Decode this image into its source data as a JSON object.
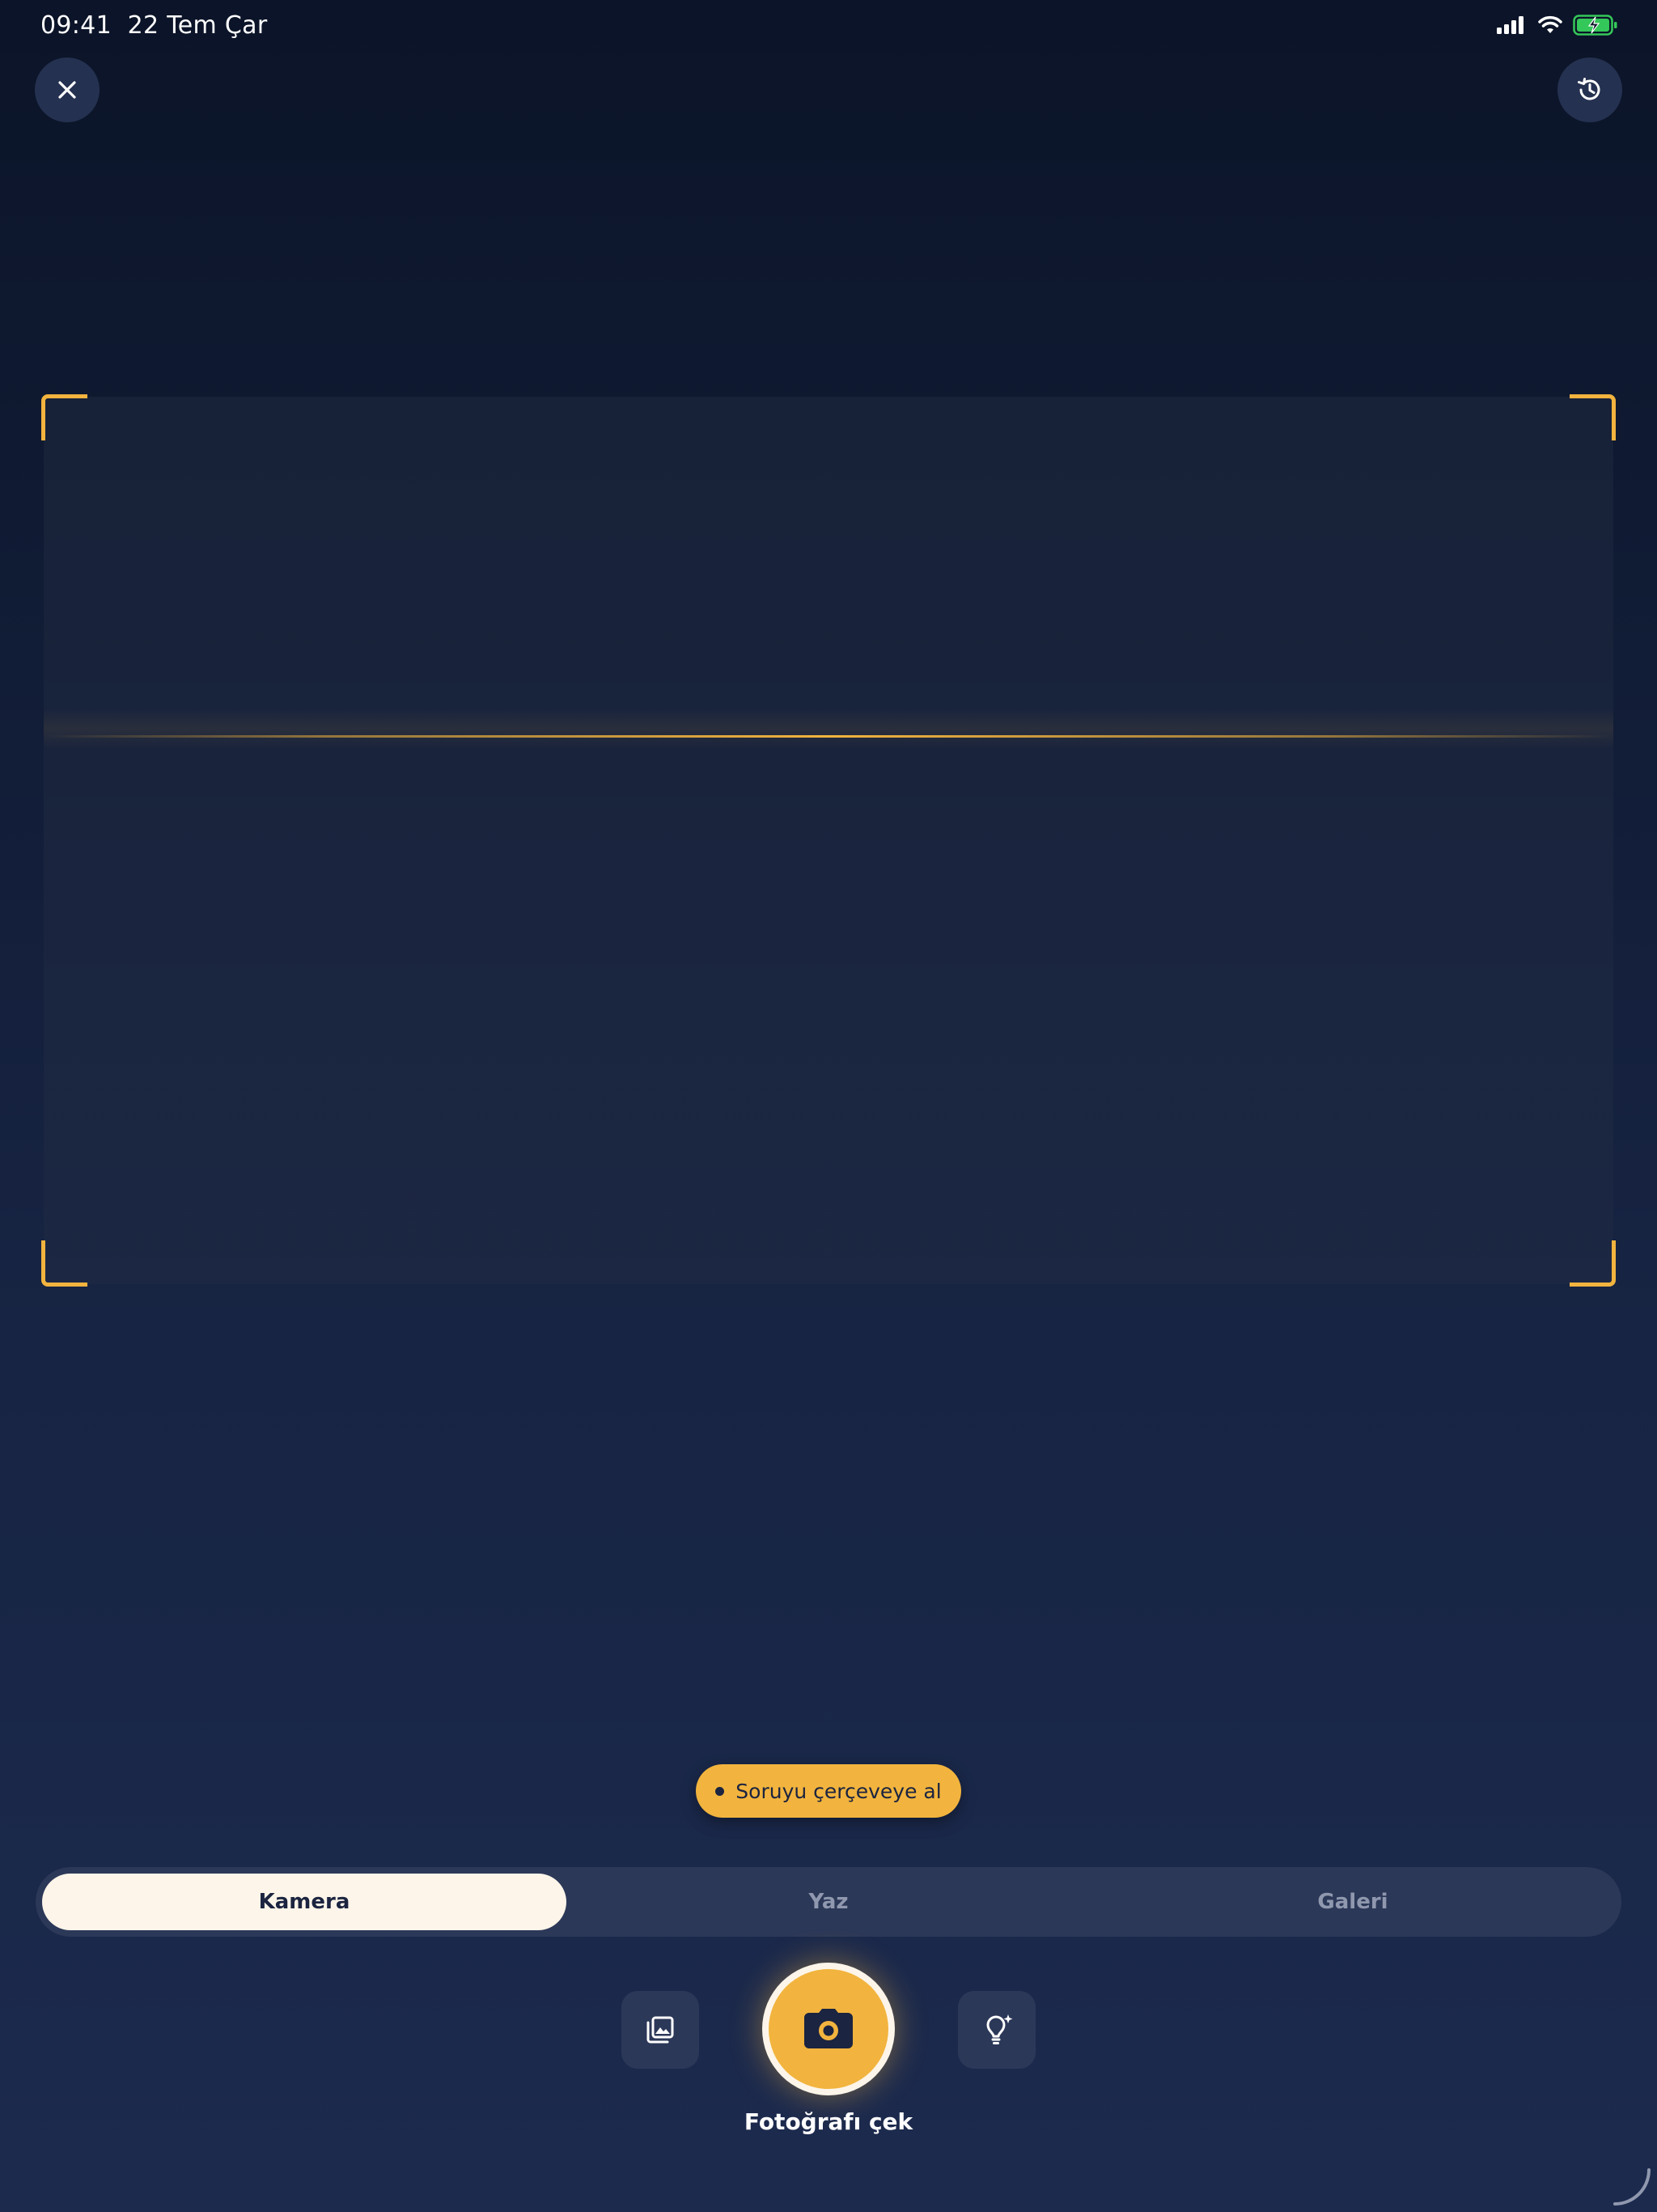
{
  "status_bar": {
    "time": "09:41",
    "date": "22 Tem Çar",
    "icons": [
      "cellular-signal-icon",
      "wifi-icon",
      "battery-charging-icon"
    ]
  },
  "top_bar": {
    "close_icon": "close-icon",
    "history_icon": "history-icon"
  },
  "scan_area": {
    "accent_color": "#f2b43e"
  },
  "hint": {
    "text": "Soruyu çerçeveye al"
  },
  "mode_tabs": {
    "items": [
      {
        "label": "Kamera",
        "selected": true
      },
      {
        "label": "Yaz",
        "selected": false
      },
      {
        "label": "Galeri",
        "selected": false
      }
    ]
  },
  "controls": {
    "gallery_icon": "photo-library-icon",
    "shutter_icon": "camera-icon",
    "tips_icon": "lightbulb-sparkle-icon",
    "shutter_label": "Fotoğrafı çek"
  },
  "colors": {
    "accent": "#f2b43e",
    "cream": "#fdf5e9",
    "background": "#111c36",
    "battery": "#34c759"
  }
}
